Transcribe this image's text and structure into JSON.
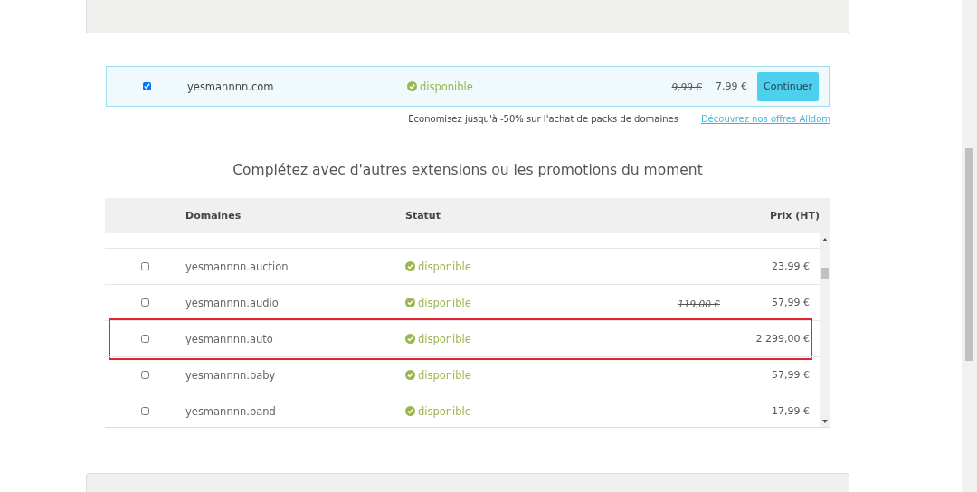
{
  "selected_domain": {
    "checked": true,
    "domain": "yesmannnn.com",
    "status": "disponible",
    "old_price": "9,99 €",
    "price": "7,99 €",
    "button": "Continuer"
  },
  "promo": {
    "text": "Economisez jusqu'à -50% sur l'achat de packs de domaines",
    "link": "Découvrez nos offres Alldom"
  },
  "heading": "Complétez avec d'autres extensions ou les promotions du moment",
  "table": {
    "columns": [
      "Domaines",
      "Statut",
      "Prix (HT)"
    ],
    "rows": [
      {
        "checked": false,
        "domain": "yesmannnn.auction",
        "status": "disponible",
        "price": "23,99 €",
        "highlighted": false
      },
      {
        "checked": false,
        "domain": "yesmannnn.audio",
        "status": "disponible",
        "old_price": "119,00 €",
        "price": "57,99 €",
        "highlighted": false
      },
      {
        "checked": false,
        "domain": "yesmannnn.auto",
        "status": "disponible",
        "price": "2 299,00 €",
        "highlighted": true
      },
      {
        "checked": false,
        "domain": "yesmannnn.baby",
        "status": "disponible",
        "price": "57,99 €",
        "highlighted": false
      },
      {
        "checked": false,
        "domain": "yesmannnn.band",
        "status": "disponible",
        "price": "17,99 €",
        "highlighted": false
      }
    ]
  }
}
